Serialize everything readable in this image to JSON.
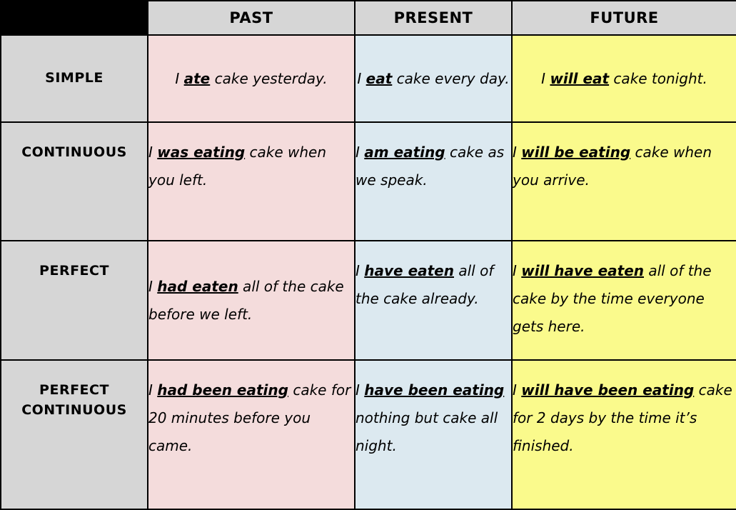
{
  "table": {
    "corner_label": "",
    "column_headers": [
      {
        "id": "past",
        "label": "PAST"
      },
      {
        "id": "present",
        "label": "PRESENT"
      },
      {
        "id": "future",
        "label": "FUTURE"
      }
    ],
    "row_headers": [
      {
        "id": "simple",
        "label": "SIMPLE"
      },
      {
        "id": "continuous",
        "label": "CONTINUOUS"
      },
      {
        "id": "perfect",
        "label": "PERFECT"
      },
      {
        "id": "perfect-continuous",
        "label_line1": "PERFECT",
        "label_line2": "CONTINUOUS"
      }
    ],
    "cells": {
      "simple": {
        "past": {
          "pre": "I ",
          "verb": "ate",
          "post": " cake yesterday."
        },
        "present": {
          "pre": "I ",
          "verb": "eat",
          "post": " cake every day."
        },
        "future": {
          "pre": "I ",
          "verb": "will eat",
          "post": " cake tonight."
        }
      },
      "continuous": {
        "past": {
          "pre": "I ",
          "verb": "was eating",
          "post": " cake when you left."
        },
        "present": {
          "pre": "I ",
          "verb": "am eating",
          "post": " cake as we speak."
        },
        "future": {
          "pre": "I ",
          "verb": "will be eating",
          "post": " cake when you arrive."
        }
      },
      "perfect": {
        "past": {
          "pre": "I ",
          "verb": "had eaten",
          "post": " all of the cake before we left."
        },
        "present": {
          "pre": "I ",
          "verb": "have eaten",
          "post": " all of the cake already."
        },
        "future": {
          "pre": "I ",
          "verb": "will have eaten",
          "post": " all of the cake by the time everyone gets here."
        }
      },
      "perfect-continuous": {
        "past": {
          "pre": "I ",
          "verb": "had been eating",
          "post": " cake for 20 minutes before you came."
        },
        "present": {
          "pre": "I ",
          "verb": "have been eating",
          "post": " nothing but cake all night."
        },
        "future": {
          "pre": "I ",
          "verb": "will have been eating",
          "post": " cake for 2 days by the time it’s finished."
        }
      }
    }
  },
  "colors": {
    "past_bg": "#f4dcdc",
    "present_bg": "#dce9f0",
    "future_bg": "#fafa8c",
    "header_bg": "#d6d6d6",
    "corner_bg": "#000000",
    "border": "#000000"
  }
}
